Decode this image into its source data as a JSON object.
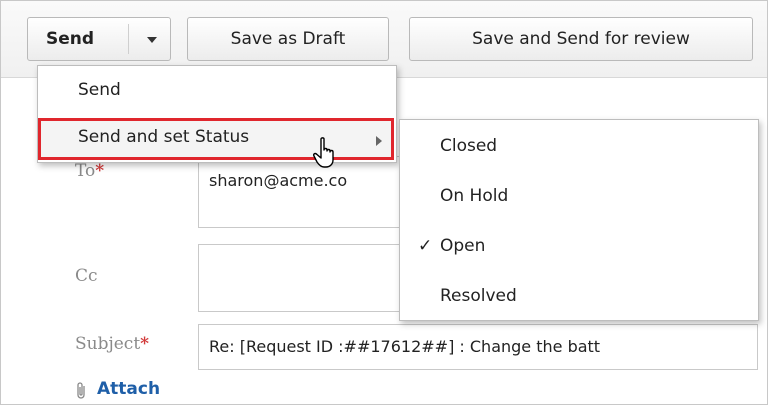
{
  "toolbar": {
    "send_label": "Send",
    "save_draft_label": "Save as Draft",
    "save_send_review_label": "Save and Send for review"
  },
  "send_menu": {
    "items": [
      {
        "label": "Send"
      },
      {
        "label": "Send and set Status"
      }
    ]
  },
  "status_menu": {
    "items": [
      {
        "label": "Closed",
        "checked": false
      },
      {
        "label": "On Hold",
        "checked": false
      },
      {
        "label": "Open",
        "checked": true
      },
      {
        "label": "Resolved",
        "checked": false
      }
    ],
    "check_glyph": "✓"
  },
  "form": {
    "to_label": "To",
    "to_value": "sharon@acme.co",
    "cc_label": "Cc",
    "subject_label": "Subject",
    "subject_value": "Re: [Request ID :##17612##] : Change the batt",
    "required_mark": "*",
    "attach_label": "Attach"
  },
  "colors": {
    "highlight_border": "#e0262d",
    "required": "#d23a3a",
    "link": "#1f5fa8"
  },
  "icons": {
    "dropdown": "caret-down-icon",
    "submenu": "caret-right-icon",
    "attach": "paperclip-icon",
    "cursor": "hand-pointer-icon"
  }
}
